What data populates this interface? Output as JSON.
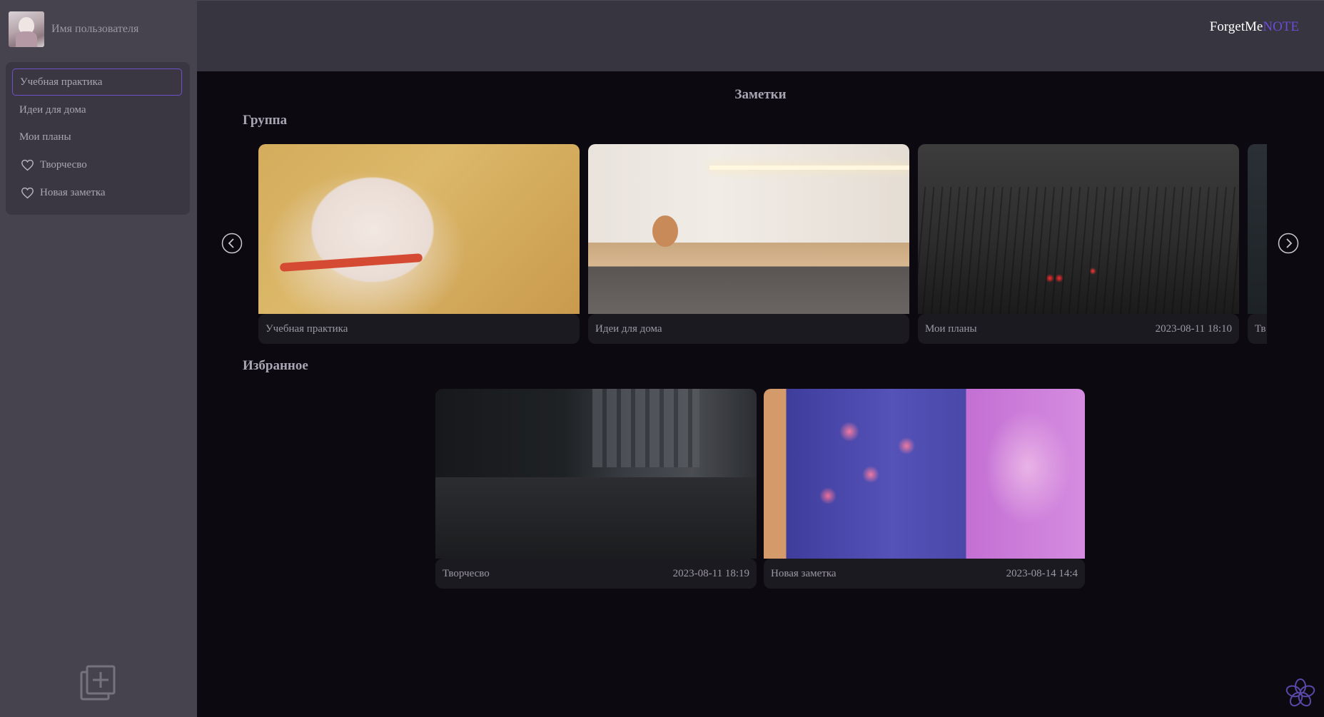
{
  "user": {
    "name": "Имя пользователя"
  },
  "sidebar": {
    "items": [
      {
        "label": "Учебная практика",
        "active": true,
        "favorite": false
      },
      {
        "label": "Идеи для дома",
        "active": false,
        "favorite": false
      },
      {
        "label": "Мои планы",
        "active": false,
        "favorite": false
      },
      {
        "label": "Творчесво",
        "active": false,
        "favorite": true
      },
      {
        "label": "Новая заметка",
        "active": false,
        "favorite": true
      }
    ],
    "add_icon": "add-note-icon"
  },
  "header": {
    "brand_main": "ForgetMe",
    "brand_accent": "NOTE"
  },
  "main": {
    "title": "Заметки",
    "group_title": "Группа",
    "favorites_title": "Избранное",
    "group_cards": [
      {
        "title": "Учебная практика",
        "date": "",
        "image": "hamster"
      },
      {
        "title": "Идеи для дома",
        "date": "",
        "image": "room"
      },
      {
        "title": "Мои планы",
        "date": "2023-08-11 18:10",
        "image": "night-flowers"
      },
      {
        "title": "Тв",
        "date": "",
        "image": "partial"
      }
    ],
    "favorite_cards": [
      {
        "title": "Творчесво",
        "date": "2023-08-11 18:19",
        "image": "city"
      },
      {
        "title": "Новая заметка",
        "date": "2023-08-14 14:4",
        "image": "blossom"
      }
    ]
  },
  "colors": {
    "sidebar_bg": "#46434f",
    "header_bg": "#37353f",
    "main_bg": "#0c0a10",
    "accent": "#6b4cd6",
    "text_muted": "#a9a6b3"
  }
}
